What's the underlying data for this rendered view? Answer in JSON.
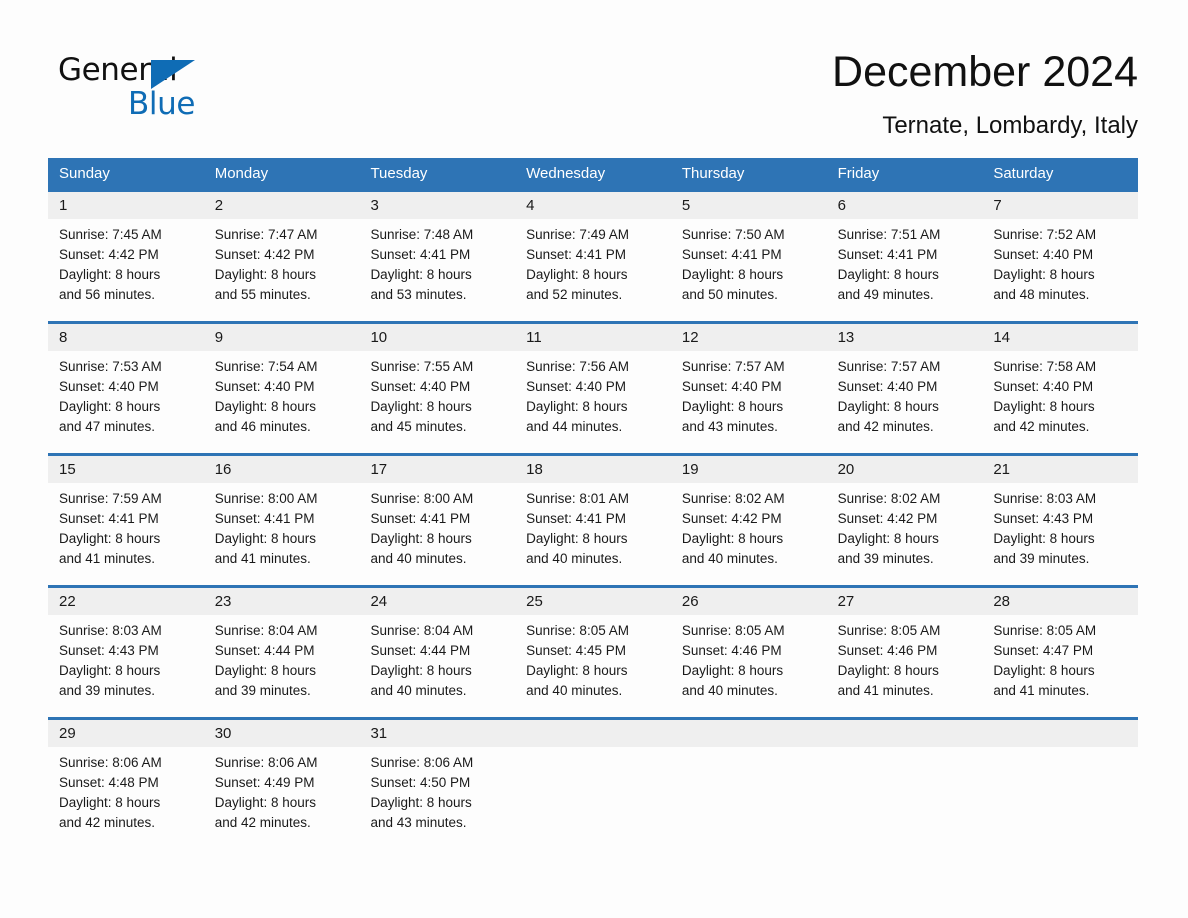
{
  "brand": {
    "word1": "General",
    "word2": "Blue",
    "accent_color": "#0f6cb5"
  },
  "header": {
    "month_title": "December 2024",
    "location": "Ternate, Lombardy, Italy"
  },
  "calendar": {
    "header_color": "#2e74b5",
    "weekdays": [
      "Sunday",
      "Monday",
      "Tuesday",
      "Wednesday",
      "Thursday",
      "Friday",
      "Saturday"
    ],
    "weeks": [
      [
        {
          "day": "1",
          "sunrise": "Sunrise: 7:45 AM",
          "sunset": "Sunset: 4:42 PM",
          "daylight_line1": "Daylight: 8 hours",
          "daylight_line2": "and 56 minutes."
        },
        {
          "day": "2",
          "sunrise": "Sunrise: 7:47 AM",
          "sunset": "Sunset: 4:42 PM",
          "daylight_line1": "Daylight: 8 hours",
          "daylight_line2": "and 55 minutes."
        },
        {
          "day": "3",
          "sunrise": "Sunrise: 7:48 AM",
          "sunset": "Sunset: 4:41 PM",
          "daylight_line1": "Daylight: 8 hours",
          "daylight_line2": "and 53 minutes."
        },
        {
          "day": "4",
          "sunrise": "Sunrise: 7:49 AM",
          "sunset": "Sunset: 4:41 PM",
          "daylight_line1": "Daylight: 8 hours",
          "daylight_line2": "and 52 minutes."
        },
        {
          "day": "5",
          "sunrise": "Sunrise: 7:50 AM",
          "sunset": "Sunset: 4:41 PM",
          "daylight_line1": "Daylight: 8 hours",
          "daylight_line2": "and 50 minutes."
        },
        {
          "day": "6",
          "sunrise": "Sunrise: 7:51 AM",
          "sunset": "Sunset: 4:41 PM",
          "daylight_line1": "Daylight: 8 hours",
          "daylight_line2": "and 49 minutes."
        },
        {
          "day": "7",
          "sunrise": "Sunrise: 7:52 AM",
          "sunset": "Sunset: 4:40 PM",
          "daylight_line1": "Daylight: 8 hours",
          "daylight_line2": "and 48 minutes."
        }
      ],
      [
        {
          "day": "8",
          "sunrise": "Sunrise: 7:53 AM",
          "sunset": "Sunset: 4:40 PM",
          "daylight_line1": "Daylight: 8 hours",
          "daylight_line2": "and 47 minutes."
        },
        {
          "day": "9",
          "sunrise": "Sunrise: 7:54 AM",
          "sunset": "Sunset: 4:40 PM",
          "daylight_line1": "Daylight: 8 hours",
          "daylight_line2": "and 46 minutes."
        },
        {
          "day": "10",
          "sunrise": "Sunrise: 7:55 AM",
          "sunset": "Sunset: 4:40 PM",
          "daylight_line1": "Daylight: 8 hours",
          "daylight_line2": "and 45 minutes."
        },
        {
          "day": "11",
          "sunrise": "Sunrise: 7:56 AM",
          "sunset": "Sunset: 4:40 PM",
          "daylight_line1": "Daylight: 8 hours",
          "daylight_line2": "and 44 minutes."
        },
        {
          "day": "12",
          "sunrise": "Sunrise: 7:57 AM",
          "sunset": "Sunset: 4:40 PM",
          "daylight_line1": "Daylight: 8 hours",
          "daylight_line2": "and 43 minutes."
        },
        {
          "day": "13",
          "sunrise": "Sunrise: 7:57 AM",
          "sunset": "Sunset: 4:40 PM",
          "daylight_line1": "Daylight: 8 hours",
          "daylight_line2": "and 42 minutes."
        },
        {
          "day": "14",
          "sunrise": "Sunrise: 7:58 AM",
          "sunset": "Sunset: 4:40 PM",
          "daylight_line1": "Daylight: 8 hours",
          "daylight_line2": "and 42 minutes."
        }
      ],
      [
        {
          "day": "15",
          "sunrise": "Sunrise: 7:59 AM",
          "sunset": "Sunset: 4:41 PM",
          "daylight_line1": "Daylight: 8 hours",
          "daylight_line2": "and 41 minutes."
        },
        {
          "day": "16",
          "sunrise": "Sunrise: 8:00 AM",
          "sunset": "Sunset: 4:41 PM",
          "daylight_line1": "Daylight: 8 hours",
          "daylight_line2": "and 41 minutes."
        },
        {
          "day": "17",
          "sunrise": "Sunrise: 8:00 AM",
          "sunset": "Sunset: 4:41 PM",
          "daylight_line1": "Daylight: 8 hours",
          "daylight_line2": "and 40 minutes."
        },
        {
          "day": "18",
          "sunrise": "Sunrise: 8:01 AM",
          "sunset": "Sunset: 4:41 PM",
          "daylight_line1": "Daylight: 8 hours",
          "daylight_line2": "and 40 minutes."
        },
        {
          "day": "19",
          "sunrise": "Sunrise: 8:02 AM",
          "sunset": "Sunset: 4:42 PM",
          "daylight_line1": "Daylight: 8 hours",
          "daylight_line2": "and 40 minutes."
        },
        {
          "day": "20",
          "sunrise": "Sunrise: 8:02 AM",
          "sunset": "Sunset: 4:42 PM",
          "daylight_line1": "Daylight: 8 hours",
          "daylight_line2": "and 39 minutes."
        },
        {
          "day": "21",
          "sunrise": "Sunrise: 8:03 AM",
          "sunset": "Sunset: 4:43 PM",
          "daylight_line1": "Daylight: 8 hours",
          "daylight_line2": "and 39 minutes."
        }
      ],
      [
        {
          "day": "22",
          "sunrise": "Sunrise: 8:03 AM",
          "sunset": "Sunset: 4:43 PM",
          "daylight_line1": "Daylight: 8 hours",
          "daylight_line2": "and 39 minutes."
        },
        {
          "day": "23",
          "sunrise": "Sunrise: 8:04 AM",
          "sunset": "Sunset: 4:44 PM",
          "daylight_line1": "Daylight: 8 hours",
          "daylight_line2": "and 39 minutes."
        },
        {
          "day": "24",
          "sunrise": "Sunrise: 8:04 AM",
          "sunset": "Sunset: 4:44 PM",
          "daylight_line1": "Daylight: 8 hours",
          "daylight_line2": "and 40 minutes."
        },
        {
          "day": "25",
          "sunrise": "Sunrise: 8:05 AM",
          "sunset": "Sunset: 4:45 PM",
          "daylight_line1": "Daylight: 8 hours",
          "daylight_line2": "and 40 minutes."
        },
        {
          "day": "26",
          "sunrise": "Sunrise: 8:05 AM",
          "sunset": "Sunset: 4:46 PM",
          "daylight_line1": "Daylight: 8 hours",
          "daylight_line2": "and 40 minutes."
        },
        {
          "day": "27",
          "sunrise": "Sunrise: 8:05 AM",
          "sunset": "Sunset: 4:46 PM",
          "daylight_line1": "Daylight: 8 hours",
          "daylight_line2": "and 41 minutes."
        },
        {
          "day": "28",
          "sunrise": "Sunrise: 8:05 AM",
          "sunset": "Sunset: 4:47 PM",
          "daylight_line1": "Daylight: 8 hours",
          "daylight_line2": "and 41 minutes."
        }
      ],
      [
        {
          "day": "29",
          "sunrise": "Sunrise: 8:06 AM",
          "sunset": "Sunset: 4:48 PM",
          "daylight_line1": "Daylight: 8 hours",
          "daylight_line2": "and 42 minutes."
        },
        {
          "day": "30",
          "sunrise": "Sunrise: 8:06 AM",
          "sunset": "Sunset: 4:49 PM",
          "daylight_line1": "Daylight: 8 hours",
          "daylight_line2": "and 42 minutes."
        },
        {
          "day": "31",
          "sunrise": "Sunrise: 8:06 AM",
          "sunset": "Sunset: 4:50 PM",
          "daylight_line1": "Daylight: 8 hours",
          "daylight_line2": "and 43 minutes."
        },
        {
          "day": "",
          "sunrise": "",
          "sunset": "",
          "daylight_line1": "",
          "daylight_line2": ""
        },
        {
          "day": "",
          "sunrise": "",
          "sunset": "",
          "daylight_line1": "",
          "daylight_line2": ""
        },
        {
          "day": "",
          "sunrise": "",
          "sunset": "",
          "daylight_line1": "",
          "daylight_line2": ""
        },
        {
          "day": "",
          "sunrise": "",
          "sunset": "",
          "daylight_line1": "",
          "daylight_line2": ""
        }
      ]
    ]
  }
}
